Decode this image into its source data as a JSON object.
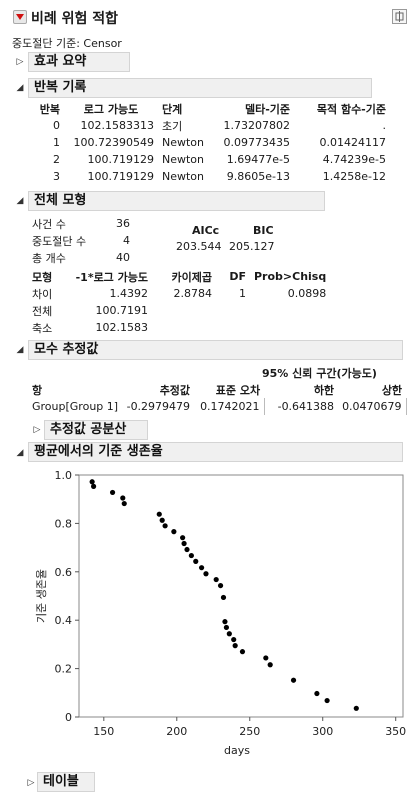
{
  "title": "비례 위험 적합",
  "censor_label": "중도절단 기준: Censor",
  "sections": {
    "effect_summary": "효과 요약",
    "iteration": "반복 기록",
    "whole_model": "전체 모형",
    "params": "모수 추정값",
    "cov": "추정값 공분산",
    "baseline": "평균에서의 기준 생존율",
    "table": "테이블"
  },
  "iteration": {
    "headers": [
      "반복",
      "로그 가능도",
      "단계",
      "델타-기준",
      "목적 함수-기준"
    ],
    "rows": [
      [
        "0",
        "102.1583313",
        "초기",
        "1.73207802",
        "."
      ],
      [
        "1",
        "100.72390549",
        "Newton",
        "0.09773435",
        "0.01424117"
      ],
      [
        "2",
        "100.719129",
        "Newton",
        "1.69477e-5",
        "4.74239e-5"
      ],
      [
        "3",
        "100.719129",
        "Newton",
        "9.8605e-13",
        "1.4258e-12"
      ]
    ]
  },
  "whole_model": {
    "counts": [
      [
        "사건 수",
        "36"
      ],
      [
        "중도절단 수",
        "4"
      ],
      [
        "총 개수",
        "40"
      ]
    ],
    "aicc_label": "AICc",
    "bic_label": "BIC",
    "aicc": "203.544",
    "bic": "205.127",
    "headers": [
      "모형",
      "-1*로그 가능도",
      "카이제곱",
      "DF",
      "Prob>Chisq"
    ],
    "rows": [
      [
        "차이",
        "1.4392",
        "2.8784",
        "1",
        "0.0898"
      ],
      [
        "전체",
        "100.7191",
        "",
        "",
        ""
      ],
      [
        "축소",
        "102.1583",
        "",
        "",
        ""
      ]
    ]
  },
  "params": {
    "ci_title": "95% 신뢰 구간(가능도)",
    "headers": [
      "항",
      "추정값",
      "표준 오차",
      "하한",
      "상한"
    ],
    "row": [
      "Group[Group 1]",
      "-0.2979479",
      "0.1742021",
      "-0.641388",
      "0.0470679"
    ]
  },
  "chart_data": {
    "type": "scatter",
    "xlabel": "days",
    "ylabel": "기준 생존율",
    "xlim": [
      133,
      355
    ],
    "ylim": [
      0,
      1.0
    ],
    "xticks": [
      150,
      200,
      250,
      300,
      350
    ],
    "yticks": [
      0,
      0.2,
      0.4,
      0.6,
      0.8,
      1.0
    ],
    "ytick_labels": [
      "0",
      "0.2",
      "0.4",
      "0.6",
      "0.8",
      "1.0"
    ],
    "points": [
      [
        142,
        0.972
      ],
      [
        143,
        0.953
      ],
      [
        156,
        0.928
      ],
      [
        163,
        0.905
      ],
      [
        164,
        0.882
      ],
      [
        188,
        0.838
      ],
      [
        190,
        0.813
      ],
      [
        192,
        0.79
      ],
      [
        198,
        0.766
      ],
      [
        204,
        0.741
      ],
      [
        205,
        0.717
      ],
      [
        207,
        0.692
      ],
      [
        210,
        0.667
      ],
      [
        213,
        0.643
      ],
      [
        217,
        0.617
      ],
      [
        220,
        0.592
      ],
      [
        227,
        0.568
      ],
      [
        230,
        0.543
      ],
      [
        232,
        0.494
      ],
      [
        233,
        0.394
      ],
      [
        234,
        0.37
      ],
      [
        236,
        0.344
      ],
      [
        239,
        0.32
      ],
      [
        240,
        0.295
      ],
      [
        245,
        0.27
      ],
      [
        261,
        0.244
      ],
      [
        264,
        0.216
      ],
      [
        280,
        0.152
      ],
      [
        296,
        0.097
      ],
      [
        303,
        0.068
      ],
      [
        323,
        0.036
      ]
    ],
    "grid": false,
    "marker_color": "#000000"
  }
}
